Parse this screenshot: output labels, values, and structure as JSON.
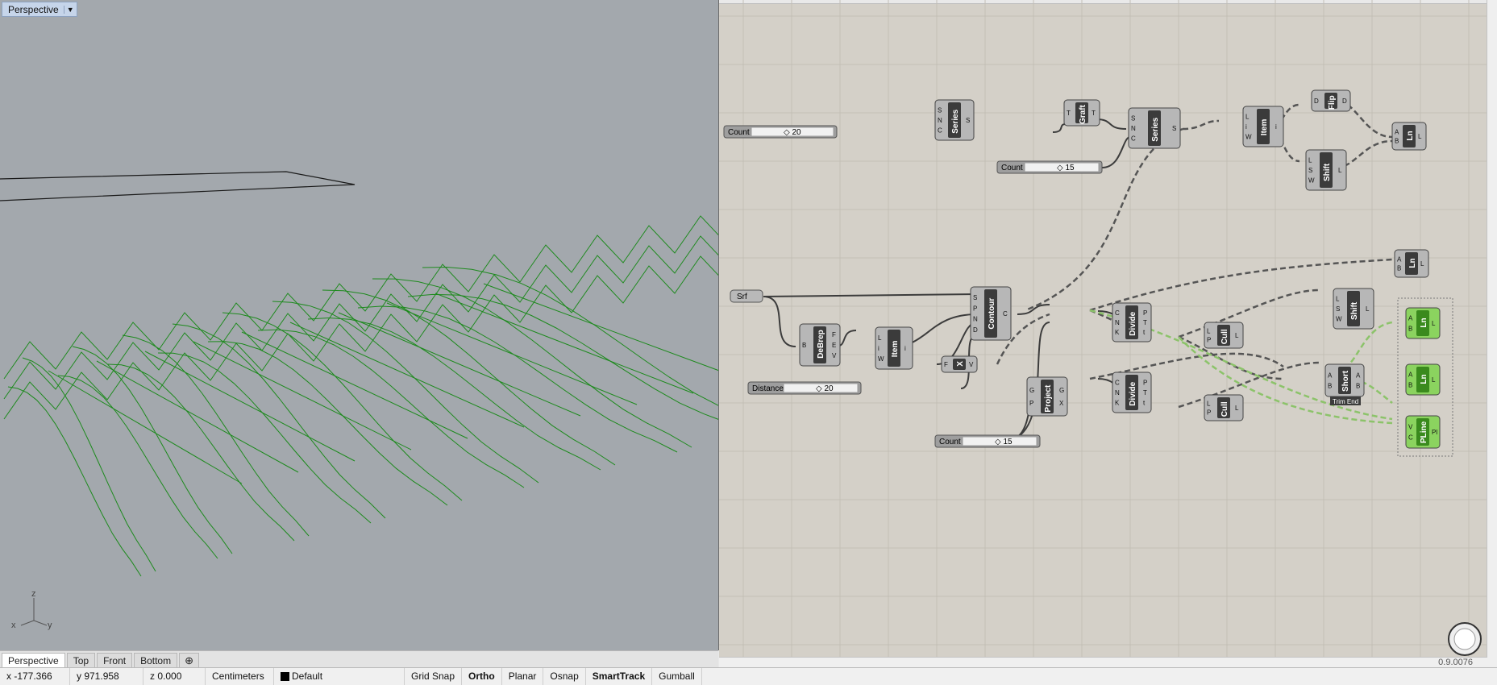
{
  "viewport": {
    "title": "Perspective",
    "axes": {
      "z": "z",
      "y": "y",
      "x": "x"
    },
    "tabs": [
      "Perspective",
      "Top",
      "Front",
      "Bottom"
    ],
    "active_tab": "Perspective",
    "add_tab_glyph": "⊕"
  },
  "statusbar": {
    "x": "x -177.366",
    "y": "y 971.958",
    "z": "z 0.000",
    "units": "Centimeters",
    "layer": "Default",
    "toggles": [
      "Grid Snap",
      "Ortho",
      "Planar",
      "Osnap",
      "SmartTrack",
      "Gumball"
    ],
    "bold_toggles": [
      "Ortho",
      "SmartTrack"
    ]
  },
  "grasshopper": {
    "version": "0.9.0076",
    "sliders": [
      {
        "label": "Count",
        "value": "20"
      },
      {
        "label": "Count",
        "value": "15"
      },
      {
        "label": "Distance",
        "value": "20"
      },
      {
        "label": "Count",
        "value": "15"
      }
    ],
    "params": [
      {
        "label": "Srf"
      }
    ],
    "components": [
      {
        "name": "Series",
        "inputs": [
          "S",
          "N",
          "C"
        ],
        "outputs": [
          "S"
        ]
      },
      {
        "name": "Graft",
        "inputs": [
          "T"
        ],
        "outputs": [
          "T"
        ]
      },
      {
        "name": "Series",
        "inputs": [
          "S",
          "N",
          "C"
        ],
        "outputs": [
          "S"
        ]
      },
      {
        "name": "Item",
        "inputs": [
          "L",
          "i",
          "W"
        ],
        "outputs": [
          "i"
        ]
      },
      {
        "name": "Flip",
        "inputs": [
          "D"
        ],
        "outputs": [
          "D"
        ]
      },
      {
        "name": "Shift",
        "inputs": [
          "L",
          "S",
          "W"
        ],
        "outputs": [
          "L"
        ]
      },
      {
        "name": "Ln",
        "inputs": [
          "A",
          "B"
        ],
        "outputs": [
          "L"
        ]
      },
      {
        "name": "DeBrep",
        "inputs": [
          "B"
        ],
        "outputs": [
          "F",
          "E",
          "V"
        ]
      },
      {
        "name": "Item",
        "inputs": [
          "L",
          "i",
          "W"
        ],
        "outputs": [
          "i"
        ]
      },
      {
        "name": "Contour",
        "inputs": [
          "S",
          "P",
          "N",
          "D"
        ],
        "outputs": [
          "C"
        ]
      },
      {
        "name": "X",
        "inputs": [
          "F"
        ],
        "outputs": [
          "V"
        ]
      },
      {
        "name": "Project",
        "inputs": [
          "G",
          "P"
        ],
        "outputs": [
          "G",
          "X"
        ]
      },
      {
        "name": "Divide",
        "inputs": [
          "C",
          "N",
          "K"
        ],
        "outputs": [
          "P",
          "T",
          "t"
        ]
      },
      {
        "name": "Divide",
        "inputs": [
          "C",
          "N",
          "K"
        ],
        "outputs": [
          "P",
          "T",
          "t"
        ]
      },
      {
        "name": "Cull",
        "inputs": [
          "L",
          "P"
        ],
        "outputs": [
          "L"
        ]
      },
      {
        "name": "Cull",
        "inputs": [
          "L",
          "P"
        ],
        "outputs": [
          "L"
        ]
      },
      {
        "name": "Ln",
        "inputs": [
          "A",
          "B"
        ],
        "outputs": [
          "L"
        ]
      },
      {
        "name": "Shift",
        "inputs": [
          "L",
          "S",
          "W"
        ],
        "outputs": [
          "L"
        ]
      },
      {
        "name": "Short",
        "inputs": [
          "A",
          "B"
        ],
        "outputs": [
          "A",
          "B"
        ]
      },
      {
        "name": "Ln",
        "inputs": [
          "A",
          "B"
        ],
        "outputs": [
          "L"
        ]
      },
      {
        "name": "Ln",
        "inputs": [
          "A",
          "B"
        ],
        "outputs": [
          "L"
        ]
      },
      {
        "name": "PLine",
        "inputs": [
          "V",
          "C"
        ],
        "outputs": [
          "Pl"
        ]
      }
    ],
    "tooltip": "Trim End"
  }
}
